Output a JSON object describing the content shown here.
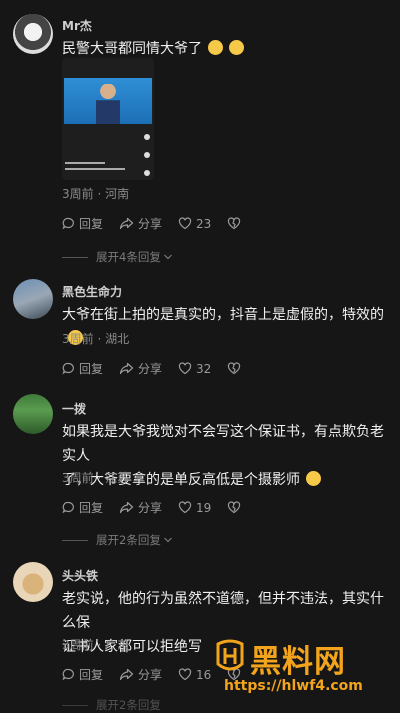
{
  "comments": [
    {
      "user": "Mr杰",
      "text": "民警大哥都同情大爷了",
      "emojis": [
        "grinning-emoji",
        "grinning-emoji"
      ],
      "meta": "3周前 · 河南",
      "reply_label": "回复",
      "share_label": "分享",
      "likes": "23",
      "expand_label": "展开4条回复",
      "has_video": true
    },
    {
      "user": "黑色生命力",
      "text": "大爷在街上拍的是真实的，抖音上是虚假的，特效的",
      "emojis": [
        "laughing-tears-emoji"
      ],
      "meta": "3周前 · 湖北",
      "reply_label": "回复",
      "share_label": "分享",
      "likes": "32"
    },
    {
      "user": "一拨",
      "text_line1": "如果我是大爷我觉对不会写这个保证书，有点欺负老实人",
      "text_line2": "了，大爷要拿的是单反高低是个摄影师",
      "emojis": [
        "sweat-smile-emoji"
      ],
      "meta": "3周前 · 江苏",
      "reply_label": "回复",
      "share_label": "分享",
      "likes": "19",
      "expand_label": "展开2条回复"
    },
    {
      "user": "头头铁",
      "text_line1": "老实说，他的行为虽然不道德，但并不违法，其实什么保",
      "text_line2": "证书人家都可以拒绝写",
      "meta": "3周前 · 广东",
      "reply_label": "回复",
      "share_label": "分享",
      "likes": "16",
      "expand_label": "展开2条回复"
    }
  ],
  "watermark": {
    "title": "黑料网",
    "url": "https://hlwf4.com"
  },
  "colors": {
    "background": "#161616",
    "watermark": "#f2a41d",
    "emoji": "#f7c948"
  }
}
